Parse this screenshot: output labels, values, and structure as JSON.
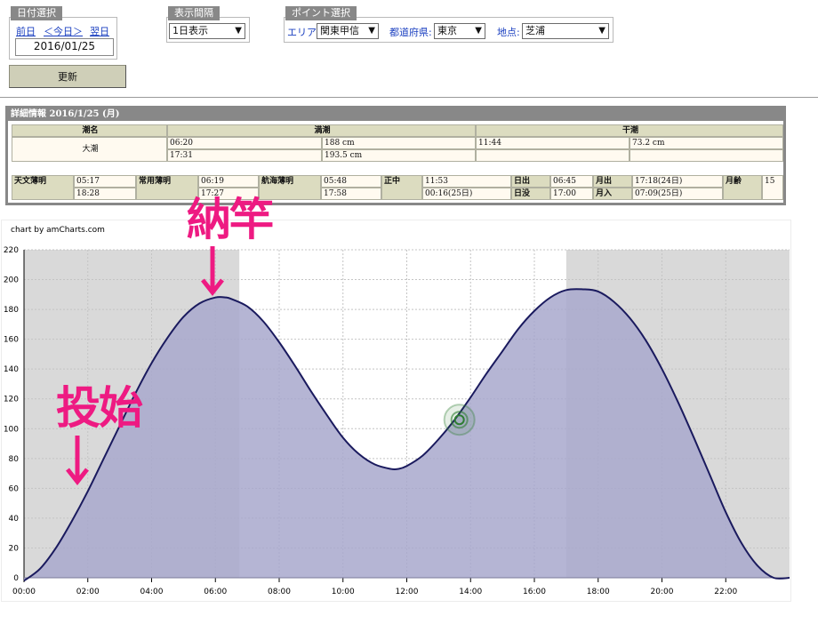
{
  "date_panel": {
    "tab": "日付選択",
    "prev": "前日",
    "today": "＜今日＞",
    "next": "翌日",
    "date": "2016/01/25"
  },
  "interval_panel": {
    "tab": "表示間隔",
    "value": "1日表示"
  },
  "point_panel": {
    "tab": "ポイント選択",
    "area_label": "エリア:",
    "area": "関東甲信",
    "pref_label": "都道府県:",
    "pref": "東京",
    "point_label": "地点:",
    "point": "芝浦"
  },
  "update_label": "更新",
  "detail": {
    "header": "詳細情報  2016/1/25 (月)",
    "col_name": "潮名",
    "col_high": "満潮",
    "col_low": "干潮",
    "tide_name": "大潮",
    "high": [
      {
        "time": "06:20",
        "level": "188 cm"
      },
      {
        "time": "17:31",
        "level": "193.5 cm"
      }
    ],
    "low": [
      {
        "time": "11:44",
        "level": "73.2 cm"
      }
    ],
    "astro_label": "天文薄明",
    "astro": [
      "05:17",
      "18:28"
    ],
    "civil_label": "常用薄明",
    "civil": [
      "06:19",
      "17:27"
    ],
    "naut_label": "航海薄明",
    "naut": [
      "05:48",
      "17:58"
    ],
    "transit_label": "正中",
    "transit": [
      "11:53",
      "00:16(25日)"
    ],
    "sunrise_label": "日出",
    "sunrise": "06:45",
    "sunset_label": "日没",
    "sunset": "17:00",
    "moonrise_label": "月出",
    "moonrise": "17:18(24日)",
    "moonset_label": "月入",
    "moonset": "07:09(25日)",
    "moonage_label": "月齢",
    "moonage": "15"
  },
  "chart_credit": "chart by amCharts.com",
  "annotations": {
    "top": "納竿",
    "left": "投始"
  },
  "colors": {
    "fill": "#a8a8cc",
    "line": "#1a1a5e",
    "night": "#d9d9d9",
    "marker": "#2e7d32",
    "annotation": "#ee1a82"
  },
  "chart_data": {
    "type": "area",
    "x_unit": "time of day (h)",
    "xlim": [
      0,
      24
    ],
    "ylim": [
      0,
      220
    ],
    "y_ticks": [
      0,
      20,
      40,
      60,
      80,
      100,
      120,
      140,
      160,
      180,
      200,
      220
    ],
    "x_ticks": [
      "00:00",
      "02:00",
      "04:00",
      "06:00",
      "08:00",
      "10:00",
      "12:00",
      "14:00",
      "16:00",
      "18:00",
      "20:00",
      "22:00"
    ],
    "night_bands": [
      [
        0,
        6.75
      ],
      [
        17.0,
        24
      ]
    ],
    "series": [
      {
        "x": [
          0.0,
          0.5,
          1.0,
          1.5,
          2.0,
          2.5,
          3.0,
          3.5,
          4.0,
          4.5,
          5.0,
          5.5,
          6.0,
          6.33,
          6.5,
          7.0,
          7.5,
          8.0,
          8.5,
          9.0,
          9.5,
          10.0,
          10.5,
          11.0,
          11.5,
          11.73,
          12.0,
          12.5,
          13.0,
          13.5,
          14.0,
          14.5,
          15.0,
          15.5,
          16.0,
          16.5,
          17.0,
          17.52,
          18.0,
          18.5,
          19.0,
          19.5,
          20.0,
          20.5,
          21.0,
          21.5,
          22.0,
          22.5,
          23.0,
          23.5,
          24.0
        ],
        "y": [
          -2,
          6,
          20,
          38,
          58,
          80,
          102,
          124,
          144,
          161,
          175,
          184,
          188,
          188,
          187,
          182,
          172,
          158,
          142,
          125,
          109,
          94,
          83,
          76,
          73,
          73,
          75,
          82,
          93,
          106,
          121,
          137,
          152,
          167,
          179,
          188,
          193,
          193.5,
          192,
          185,
          174,
          159,
          140,
          118,
          94,
          69,
          44,
          23,
          8,
          0,
          0
        ]
      }
    ],
    "marker": {
      "x": 13.65,
      "y": 106
    }
  }
}
